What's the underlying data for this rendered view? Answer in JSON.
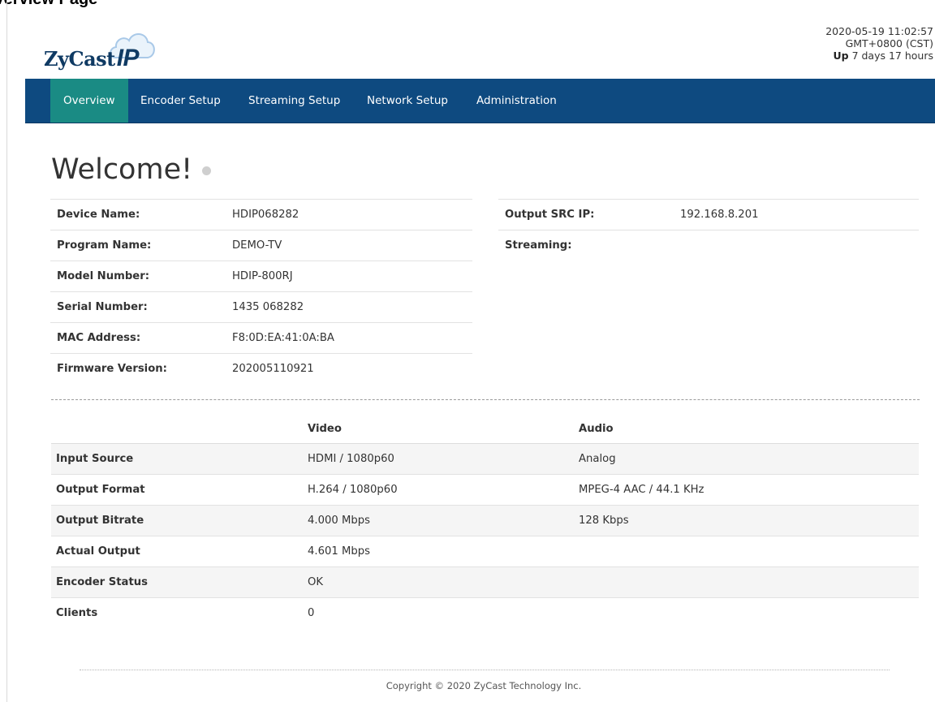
{
  "page": {
    "heading": "Overview Page"
  },
  "brand": {
    "logo_text": "ZyCast",
    "logo_ip": "IP"
  },
  "clock": {
    "datetime": "2020-05-19 11:02:57",
    "timezone": "GMT+0800 (CST)",
    "up_label": "Up",
    "uptime": "7 days 17 hours"
  },
  "nav": {
    "items": [
      "Overview",
      "Encoder Setup",
      "Streaming Setup",
      "Network Setup",
      "Administration"
    ],
    "active": "Overview"
  },
  "welcome": {
    "title": "Welcome!"
  },
  "device": {
    "rows": [
      {
        "label": "Device Name:",
        "value": "HDIP068282"
      },
      {
        "label": "Program Name:",
        "value": "DEMO-TV"
      },
      {
        "label": "Model Number:",
        "value": "HDIP-800RJ"
      },
      {
        "label": "Serial Number:",
        "value": "1435 068282"
      },
      {
        "label": "MAC Address:",
        "value": "F8:0D:EA:41:0A:BA"
      },
      {
        "label": "Firmware Version:",
        "value": "202005110921"
      }
    ]
  },
  "output": {
    "rows": [
      {
        "label": "Output SRC IP:",
        "value": "192.168.8.201"
      },
      {
        "label": "Streaming:",
        "value": ""
      }
    ]
  },
  "av": {
    "headers": [
      "",
      "Video",
      "Audio"
    ],
    "rows": [
      {
        "label": "Input Source",
        "video": "HDMI / 1080p60",
        "audio": "Analog"
      },
      {
        "label": "Output Format",
        "video": "H.264 / 1080p60",
        "audio": "MPEG-4 AAC / 44.1 KHz"
      },
      {
        "label": "Output Bitrate",
        "video": "4.000 Mbps",
        "audio": "128 Kbps"
      },
      {
        "label": "Actual Output",
        "video": "4.601 Mbps",
        "audio": ""
      },
      {
        "label": "Encoder Status",
        "video": "OK",
        "audio": ""
      },
      {
        "label": "Clients",
        "video": "0",
        "audio": ""
      }
    ]
  },
  "footer": {
    "copyright": "Copyright © 2020 ZyCast Technology Inc."
  },
  "colors": {
    "nav_bg": "#0e4a80",
    "nav_active": "#1a8b84",
    "brand": "#0f3a63"
  }
}
